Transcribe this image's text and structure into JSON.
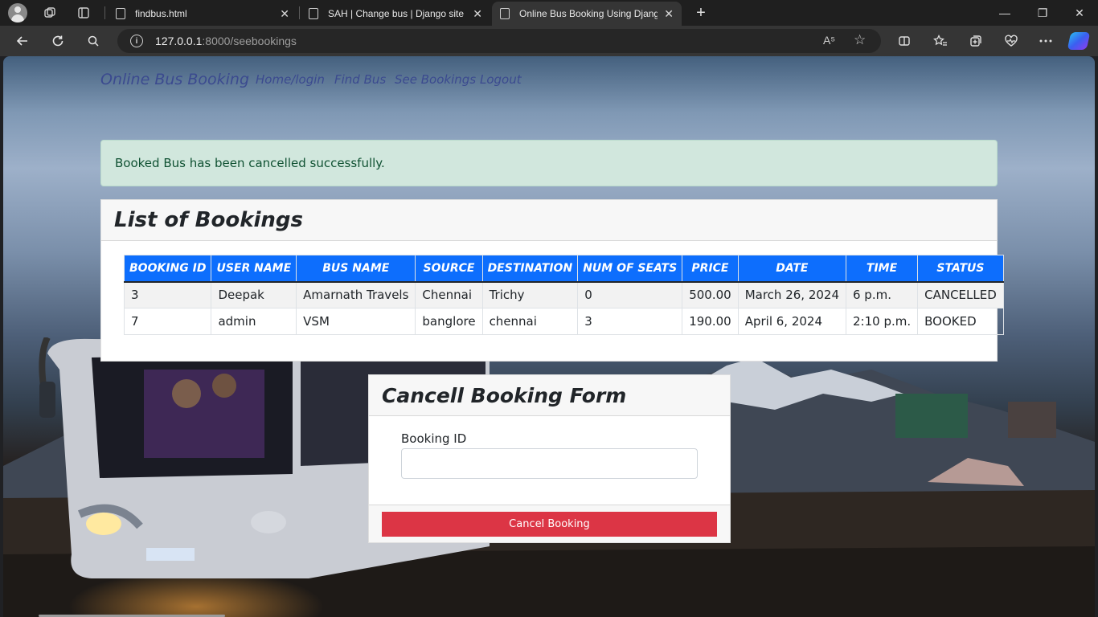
{
  "browser": {
    "tabs": [
      {
        "title": "findbus.html",
        "close": "✕"
      },
      {
        "title": "SAH | Change bus | Django site admin",
        "close": "✕"
      },
      {
        "title": "Online Bus Booking Using Django",
        "close": "✕"
      }
    ],
    "new_tab": "+",
    "address": {
      "host": "127.0.0.1",
      "rest": ":8000/seebookings"
    },
    "read_aloud": "A⁵",
    "favorite": "☆",
    "window": {
      "minimize": "—",
      "restore": "❐",
      "close": "✕"
    }
  },
  "site": {
    "brand": "Online Bus Booking",
    "nav": [
      "Home/login",
      "Find Bus",
      "See Bookings",
      "Logout"
    ]
  },
  "alert": {
    "message": "Booked Bus has been cancelled successfully."
  },
  "bookings": {
    "title": "List of Bookings",
    "columns": [
      "BOOKING ID",
      "USER NAME",
      "BUS NAME",
      "SOURCE",
      "DESTINATION",
      "NUM OF SEATS",
      "PRICE",
      "DATE",
      "TIME",
      "STATUS"
    ],
    "rows": [
      [
        "3",
        "Deepak",
        "Amarnath Travels",
        "Chennai",
        "Trichy",
        "0",
        "500.00",
        "March 26, 2024",
        "6 p.m.",
        "CANCELLED"
      ],
      [
        "7",
        "admin",
        "VSM",
        "banglore",
        "chennai",
        "3",
        "190.00",
        "April 6, 2024",
        "2:10 p.m.",
        "BOOKED"
      ]
    ]
  },
  "cancel_form": {
    "title": "Cancell Booking Form",
    "label": "Booking ID",
    "value": "",
    "button": "Cancel Booking"
  },
  "colors": {
    "primary": "#0d6efd",
    "danger": "#dc3545",
    "success_bg": "#d1e7dd",
    "success_text": "#0f5132"
  }
}
